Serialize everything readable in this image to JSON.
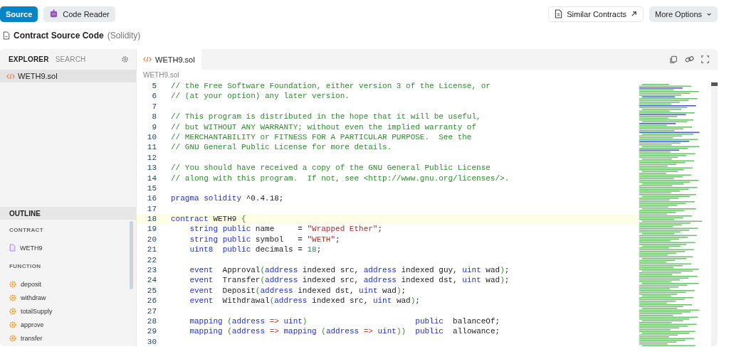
{
  "top_buttons": [
    {
      "label": "Source",
      "selected": true,
      "kind": "plain"
    },
    {
      "label": "Code Reader",
      "selected": false,
      "kind": "robot"
    }
  ],
  "right_buttons": [
    {
      "label": "Similar Contracts",
      "kind": "link"
    },
    {
      "label": "More Options",
      "kind": "menu"
    }
  ],
  "heading": {
    "title": "Contract Source Code",
    "suffix": "(Solidity)"
  },
  "sidebar": {
    "tabs": [
      {
        "label": "EXPLORER",
        "selected": true
      },
      {
        "label": "SEARCH",
        "selected": false
      }
    ],
    "files": [
      {
        "name": "WETH9.sol",
        "selected": true
      }
    ],
    "outline": {
      "title": "OUTLINE",
      "groups": [
        {
          "title": "CONTRACT",
          "kind": "contract",
          "items": [
            "WETH9"
          ]
        },
        {
          "title": "FUNCTION",
          "kind": "function",
          "items": [
            "deposit",
            "withdraw",
            "totalSupply",
            "approve",
            "transfer"
          ]
        }
      ]
    }
  },
  "editor": {
    "tab": "WETH9.sol",
    "breadcrumb": "WETH9.sol",
    "lines": [
      {
        "num": "5",
        "highlighted": false,
        "tokens": [
          {
            "kind": "comment",
            "text": "// the Free Software Foundation, either version 3 of the License, or"
          }
        ]
      },
      {
        "num": "6",
        "highlighted": false,
        "tokens": [
          {
            "kind": "comment",
            "text": "// (at your option) any later version."
          }
        ]
      },
      {
        "num": "7",
        "highlighted": false
      },
      {
        "num": "8",
        "highlighted": false,
        "tokens": [
          {
            "kind": "comment",
            "text": "// This program is distributed in the hope that it will be useful,"
          }
        ]
      },
      {
        "num": "9",
        "highlighted": false,
        "tokens": [
          {
            "kind": "comment",
            "text": "// but WITHOUT ANY WARRANTY; without even the implied warranty of"
          }
        ]
      },
      {
        "num": "10",
        "highlighted": false,
        "tokens": [
          {
            "kind": "comment",
            "text": "// MERCHANTABILITY or FITNESS FOR A PARTICULAR PURPOSE.  See the"
          }
        ]
      },
      {
        "num": "11",
        "highlighted": false,
        "tokens": [
          {
            "kind": "comment",
            "text": "// GNU General Public License for more details."
          }
        ]
      },
      {
        "num": "12",
        "highlighted": false
      },
      {
        "num": "13",
        "highlighted": false,
        "tokens": [
          {
            "kind": "comment",
            "text": "// You should have received a copy of the GNU General Public License"
          }
        ]
      },
      {
        "num": "14",
        "highlighted": false,
        "tokens": [
          {
            "kind": "comment",
            "text": "// along with this program.  If not, see <http://www.gnu.org/licenses/>."
          }
        ]
      },
      {
        "num": "15",
        "highlighted": false
      },
      {
        "num": "16",
        "highlighted": false,
        "tokens": [
          {
            "kind": "keyword",
            "text": "pragma "
          },
          {
            "kind": "keyword",
            "text": "solidity"
          },
          {
            "kind": "plain",
            "text": " ^0.4.18;"
          }
        ]
      },
      {
        "num": "17",
        "highlighted": false
      },
      {
        "num": "18",
        "highlighted": true,
        "tokens": [
          {
            "kind": "keyword",
            "text": "contract"
          },
          {
            "kind": "plain",
            "text": " WETH9 "
          },
          {
            "kind": "bracket",
            "text": "{"
          }
        ]
      },
      {
        "num": "19",
        "highlighted": false,
        "tokens": [
          {
            "kind": "keyword",
            "text": "    string "
          },
          {
            "kind": "keyword",
            "text": "public"
          },
          {
            "kind": "plain",
            "text": " name     = "
          },
          {
            "kind": "string",
            "text": "\"Wrapped Ether\""
          },
          {
            "kind": "plain",
            "text": ";"
          }
        ]
      },
      {
        "num": "20",
        "highlighted": false,
        "tokens": [
          {
            "kind": "keyword",
            "text": "    string "
          },
          {
            "kind": "keyword",
            "text": "public"
          },
          {
            "kind": "plain",
            "text": " symbol   = "
          },
          {
            "kind": "string",
            "text": "\"WETH\""
          },
          {
            "kind": "plain",
            "text": ";"
          }
        ]
      },
      {
        "num": "21",
        "highlighted": false,
        "tokens": [
          {
            "kind": "keyword",
            "text": "    uint8  "
          },
          {
            "kind": "keyword",
            "text": "public"
          },
          {
            "kind": "plain",
            "text": " decimals = "
          },
          {
            "kind": "number",
            "text": "18"
          },
          {
            "kind": "plain",
            "text": ";"
          }
        ]
      },
      {
        "num": "22",
        "highlighted": false
      },
      {
        "num": "23",
        "highlighted": false,
        "tokens": [
          {
            "kind": "keyword",
            "text": "    event"
          },
          {
            "kind": "plain",
            "text": "  Approval"
          },
          {
            "kind": "bracket",
            "text": "("
          },
          {
            "kind": "keyword",
            "text": "address"
          },
          {
            "kind": "plain",
            "text": " indexed src, "
          },
          {
            "kind": "keyword",
            "text": "address"
          },
          {
            "kind": "plain",
            "text": " indexed guy, "
          },
          {
            "kind": "keyword",
            "text": "uint"
          },
          {
            "kind": "plain",
            "text": " wad"
          },
          {
            "kind": "bracket",
            "text": ")"
          },
          {
            "kind": "plain",
            "text": ";"
          }
        ]
      },
      {
        "num": "24",
        "highlighted": false,
        "tokens": [
          {
            "kind": "keyword",
            "text": "    event"
          },
          {
            "kind": "plain",
            "text": "  Transfer"
          },
          {
            "kind": "bracket",
            "text": "("
          },
          {
            "kind": "keyword",
            "text": "address"
          },
          {
            "kind": "plain",
            "text": " indexed src, "
          },
          {
            "kind": "keyword",
            "text": "address"
          },
          {
            "kind": "plain",
            "text": " indexed dst, "
          },
          {
            "kind": "keyword",
            "text": "uint"
          },
          {
            "kind": "plain",
            "text": " wad"
          },
          {
            "kind": "bracket",
            "text": ")"
          },
          {
            "kind": "plain",
            "text": ";"
          }
        ]
      },
      {
        "num": "25",
        "highlighted": false,
        "tokens": [
          {
            "kind": "keyword",
            "text": "    event"
          },
          {
            "kind": "plain",
            "text": "  Deposit"
          },
          {
            "kind": "bracket",
            "text": "("
          },
          {
            "kind": "keyword",
            "text": "address"
          },
          {
            "kind": "plain",
            "text": " indexed dst, "
          },
          {
            "kind": "keyword",
            "text": "uint"
          },
          {
            "kind": "plain",
            "text": " wad"
          },
          {
            "kind": "bracket",
            "text": ")"
          },
          {
            "kind": "plain",
            "text": ";"
          }
        ]
      },
      {
        "num": "26",
        "highlighted": false,
        "tokens": [
          {
            "kind": "keyword",
            "text": "    event"
          },
          {
            "kind": "plain",
            "text": "  Withdrawal"
          },
          {
            "kind": "bracket",
            "text": "("
          },
          {
            "kind": "keyword",
            "text": "address"
          },
          {
            "kind": "plain",
            "text": " indexed src, "
          },
          {
            "kind": "keyword",
            "text": "uint"
          },
          {
            "kind": "plain",
            "text": " wad"
          },
          {
            "kind": "bracket",
            "text": ")"
          },
          {
            "kind": "plain",
            "text": ";"
          }
        ]
      },
      {
        "num": "27",
        "highlighted": false
      },
      {
        "num": "28",
        "highlighted": false,
        "tokens": [
          {
            "kind": "keyword",
            "text": "    mapping "
          },
          {
            "kind": "bracket",
            "text": "("
          },
          {
            "kind": "keyword",
            "text": "address "
          },
          {
            "kind": "operator",
            "text": "=> "
          },
          {
            "kind": "keyword",
            "text": "uint"
          },
          {
            "kind": "bracket",
            "text": ")"
          },
          {
            "kind": "keyword",
            "text": "                       public"
          },
          {
            "kind": "plain",
            "text": "  balanceOf;"
          }
        ]
      },
      {
        "num": "29",
        "highlighted": false,
        "tokens": [
          {
            "kind": "keyword",
            "text": "    mapping "
          },
          {
            "kind": "bracket",
            "text": "("
          },
          {
            "kind": "keyword",
            "text": "address "
          },
          {
            "kind": "operator",
            "text": "=> "
          },
          {
            "kind": "keyword",
            "text": "mapping "
          },
          {
            "kind": "bracket",
            "text": "("
          },
          {
            "kind": "keyword",
            "text": "address "
          },
          {
            "kind": "operator",
            "text": "=> "
          },
          {
            "kind": "keyword",
            "text": "uint"
          },
          {
            "kind": "bracket",
            "text": "))"
          },
          {
            "kind": "keyword",
            "text": "  public"
          },
          {
            "kind": "plain",
            "text": "  allowance;"
          }
        ]
      },
      {
        "num": "30",
        "highlighted": false
      }
    ]
  }
}
